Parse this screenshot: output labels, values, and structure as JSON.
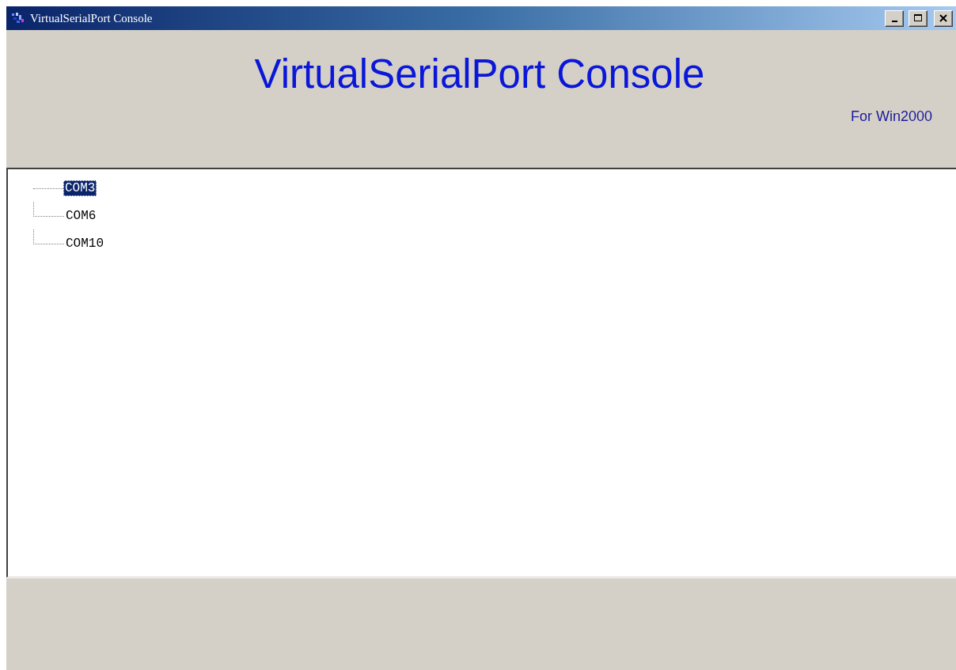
{
  "window": {
    "title": "VirtualSerialPort Console"
  },
  "header": {
    "title": "VirtualSerialPort Console",
    "subtitle": "For Win2000"
  },
  "tree": {
    "items": [
      {
        "label": "COM3",
        "selected": true
      },
      {
        "label": "COM6",
        "selected": false
      },
      {
        "label": "COM10",
        "selected": false
      }
    ]
  }
}
